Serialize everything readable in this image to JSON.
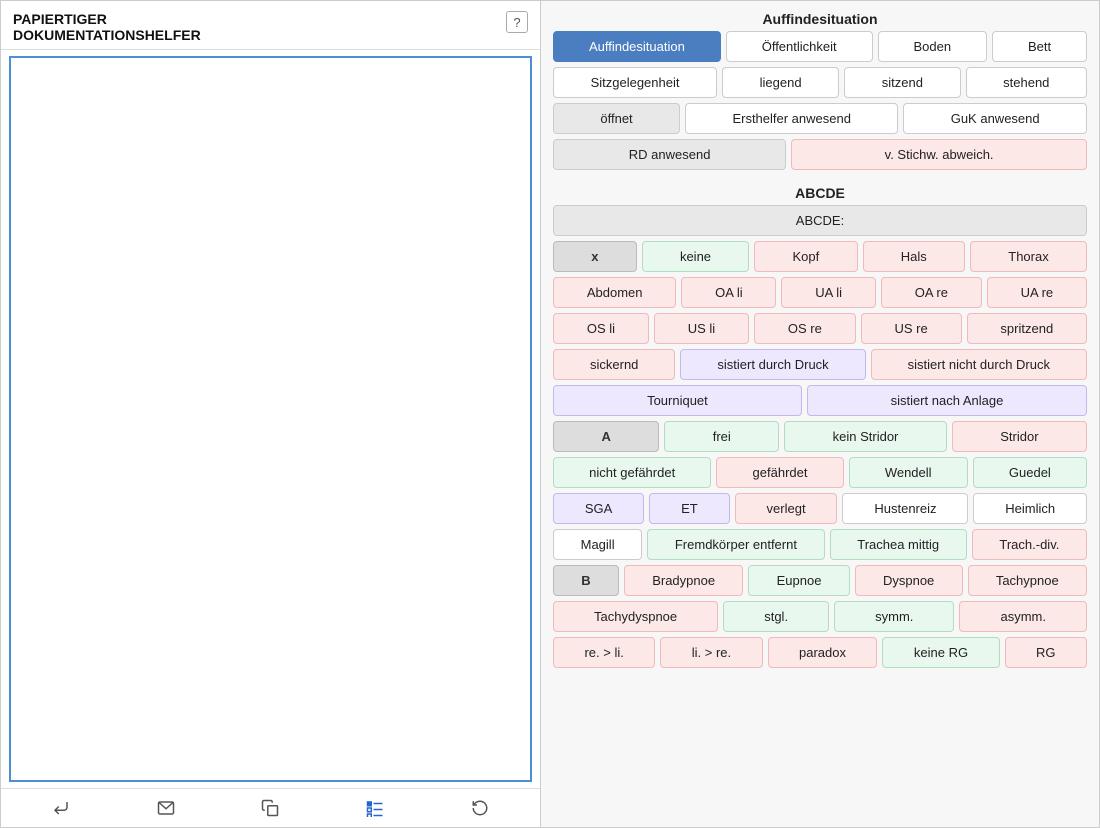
{
  "app": {
    "name": "PAPIERTIGER",
    "subtitle": "DOKUMENTATIONSHELFER",
    "help_label": "?"
  },
  "toolbar": {
    "enter_label": "↵",
    "delete_label": "✉",
    "copy_label": "⧉",
    "list_label": "☑",
    "reset_label": "↺"
  },
  "section_auffindesituation": {
    "title": "Auffindesituation",
    "buttons_row1": [
      "Auffindesituation",
      "Öffentlichkeit",
      "Boden",
      "Bett"
    ],
    "buttons_row2": [
      "Sitzgelegenheit",
      "liegend",
      "sitzend",
      "stehend"
    ],
    "buttons_row3": [
      "öffnet",
      "Ersthelfer anwesend",
      "GuK anwesend"
    ],
    "buttons_row4": [
      "RD anwesend",
      "v. Stichw. abweich."
    ]
  },
  "section_abcde": {
    "title": "ABCDE",
    "abcde_label": "ABCDE:",
    "buttons_xrow": [
      "x",
      "keine",
      "Kopf",
      "Hals",
      "Thorax"
    ],
    "buttons_body": [
      "Abdomen",
      "OA li",
      "UA li",
      "OA re",
      "UA re"
    ],
    "buttons_legs": [
      "OS li",
      "US li",
      "OS re",
      "US re",
      "spritzend"
    ],
    "buttons_bleed": [
      "sickernd",
      "sistiert durch Druck",
      "sistiert nicht durch Druck"
    ],
    "buttons_tourniquet": [
      "Tourniquet",
      "sistiert nach Anlage"
    ],
    "a_label": "A",
    "a_row1": [
      "frei",
      "kein Stridor",
      "Stridor"
    ],
    "a_row2": [
      "nicht gefährdet",
      "gefährdet",
      "Wendell",
      "Guedel"
    ],
    "a_row3": [
      "SGA",
      "ET",
      "verlegt",
      "Hustenreiz",
      "Heimlich"
    ],
    "a_row4": [
      "Magill",
      "Fremdkörper entfernt",
      "Trachea mittig",
      "Trach.-div."
    ],
    "b_label": "B",
    "b_row1": [
      "Bradypnoe",
      "Eupnoe",
      "Dyspnoe",
      "Tachypnoe"
    ],
    "b_row2": [
      "Tachydyspnoe",
      "stgl.",
      "symm.",
      "asymm."
    ],
    "b_row3": [
      "re. > li.",
      "li. > re.",
      "paradox",
      "keine RG",
      "RG"
    ]
  }
}
